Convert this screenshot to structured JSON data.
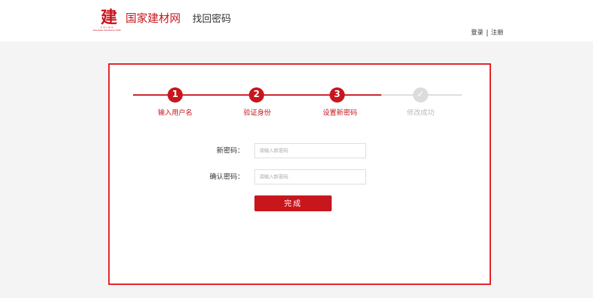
{
  "header": {
    "logo_glyph": "建",
    "logo_en_line1": "C H I N A",
    "logo_en_line2": "BUILDING MATERIALS WEB",
    "site_name": "国家建材网",
    "page_name": "找回密码",
    "login_label": "登录",
    "register_label": "注册"
  },
  "steps": [
    {
      "number": "1",
      "label": "输入用户名",
      "state": "done"
    },
    {
      "number": "2",
      "label": "验证身份",
      "state": "done"
    },
    {
      "number": "3",
      "label": "设置新密码",
      "state": "done"
    },
    {
      "number": "✓",
      "label": "修改成功",
      "state": "todo"
    }
  ],
  "form": {
    "new_password_label": "新密码：",
    "new_password_placeholder": "请输入新密码",
    "new_password_value": "",
    "confirm_password_label": "确认密码：",
    "confirm_password_placeholder": "请输入新密码",
    "confirm_password_value": "",
    "submit_label": "完成"
  },
  "colors": {
    "accent": "#c8161d",
    "card_border": "#e0171e",
    "inactive": "#dcdcdc"
  }
}
